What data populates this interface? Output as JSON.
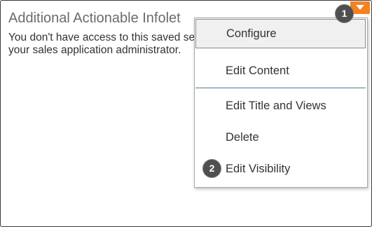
{
  "card": {
    "title": "Additional Actionable Infolet",
    "message_line1": "You don't have access to this saved search. Contact",
    "message_line2": "your sales application administrator."
  },
  "actions_menu": {
    "trigger_icon": "chevron-down-icon",
    "trigger_color": "#f58220",
    "items": [
      {
        "label": "Configure"
      },
      {
        "label": "Edit Content"
      },
      {
        "label": "Edit Title and Views"
      },
      {
        "label": "Delete"
      },
      {
        "label": "Edit Visibility"
      }
    ]
  },
  "callouts": {
    "first": "1",
    "second": "2"
  }
}
